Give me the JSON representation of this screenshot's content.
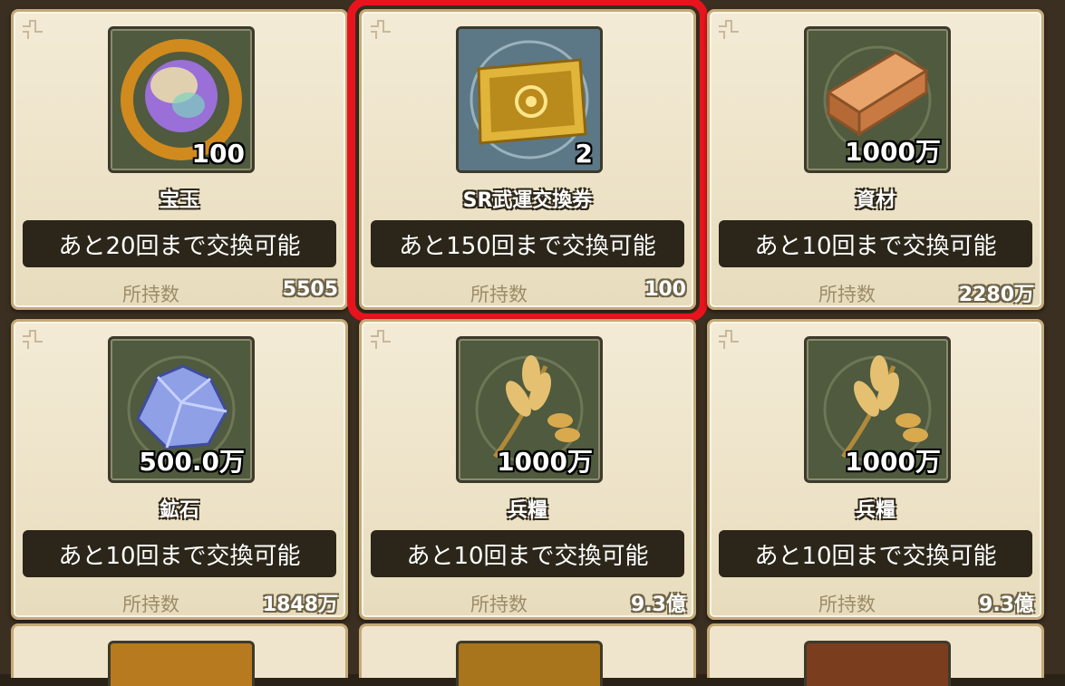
{
  "items": [
    {
      "name": "宝玉",
      "qty": "100",
      "limit": "あと20回まで交換可能",
      "owned_label": "所持数",
      "owned": "5505",
      "icon": "jewel-orb-icon",
      "selected": false
    },
    {
      "name": "SR武運交換券",
      "qty": "2",
      "limit": "あと150回まで交換可能",
      "owned_label": "所持数",
      "owned": "100",
      "icon": "ticket-icon",
      "selected": true
    },
    {
      "name": "資材",
      "qty": "1000万",
      "limit": "あと10回まで交換可能",
      "owned_label": "所持数",
      "owned": "2280万",
      "icon": "lumber-icon",
      "selected": false
    },
    {
      "name": "鉱石",
      "qty": "500.0万",
      "limit": "あと10回まで交換可能",
      "owned_label": "所持数",
      "owned": "1848万",
      "icon": "ore-crystal-icon",
      "selected": false
    },
    {
      "name": "兵糧",
      "qty": "1000万",
      "limit": "あと10回まで交換可能",
      "owned_label": "所持数",
      "owned": "9.3億",
      "icon": "wheat-icon",
      "selected": false
    },
    {
      "name": "兵糧",
      "qty": "1000万",
      "limit": "あと10回まで交換可能",
      "owned_label": "所持数",
      "owned": "9.3億",
      "icon": "wheat-icon",
      "selected": false
    }
  ],
  "colors": {
    "selection_outline": "#e8141d",
    "card_bg": "#f3ebd6",
    "limit_bg": "#2b2619"
  }
}
